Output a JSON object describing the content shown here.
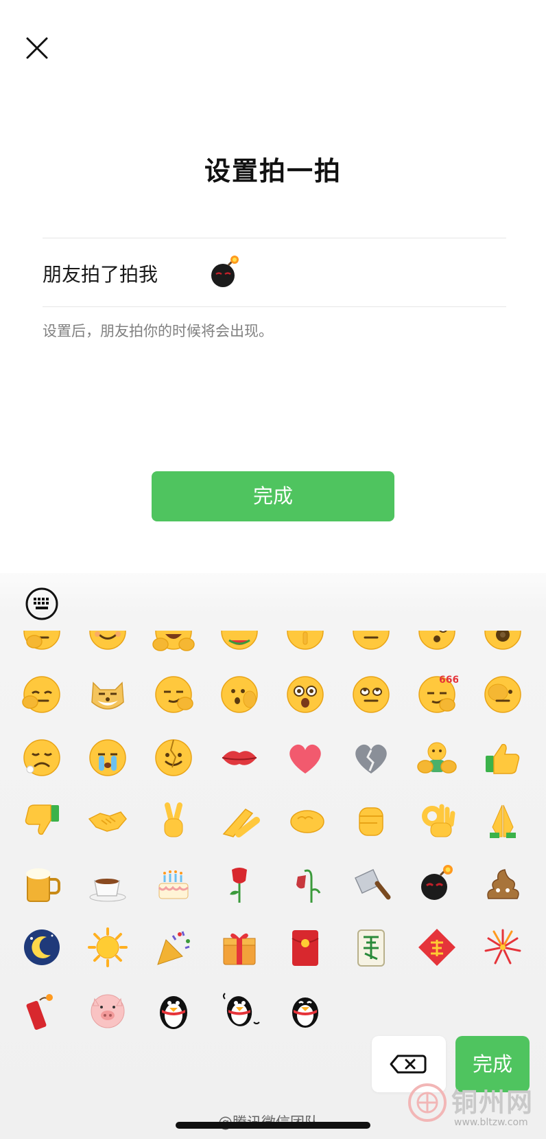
{
  "page": {
    "title": "设置拍一拍",
    "tickle_label": "朋友拍了拍我",
    "tickle_suffix_icon": "bomb-emoji",
    "hint": "设置后，朋友拍你的时候将会出现。",
    "done_label": "完成"
  },
  "panel": {
    "keyboard_icon": "keyboard-icon",
    "backspace_icon": "backspace-icon",
    "done_label": "完成"
  },
  "emoji_rows": [
    [
      "thinking",
      "smile",
      "v-sign-laugh",
      "eating-watermelon",
      "shush",
      "meh",
      "surprised",
      "sunglasses-partial"
    ],
    [
      "facepalm-think",
      "doge",
      "smirk-ok",
      "wow-cover",
      "star-eyes",
      "eye-roll",
      "666",
      "hiding-face"
    ],
    [
      "sad",
      "crying",
      "broken-face",
      "lips",
      "heart",
      "broken-heart",
      "hug",
      "thumbs-up"
    ],
    [
      "thumbs-down",
      "handshake",
      "victory",
      "salute",
      "fist-bump-side",
      "fist",
      "ok-hand",
      "pray"
    ],
    [
      "beer",
      "coffee",
      "cake",
      "rose",
      "wilted-flower",
      "cleaver",
      "bomb",
      "poop"
    ],
    [
      "moon",
      "sun",
      "party-popper",
      "gift",
      "red-envelope",
      "mahjong-fa",
      "fu",
      "fireworks"
    ],
    [
      "firecracker",
      "pig",
      "penguin",
      "penguin-dance",
      "penguin-bow"
    ]
  ],
  "colors": {
    "accent_green": "#4fc45f",
    "emoji_yellow": "#ffc83d",
    "hint_gray": "#808080"
  },
  "watermark": {
    "weibo": "@腾讯微信团队",
    "site_name": "铜州网",
    "site_url": "www.bltzw.com"
  }
}
